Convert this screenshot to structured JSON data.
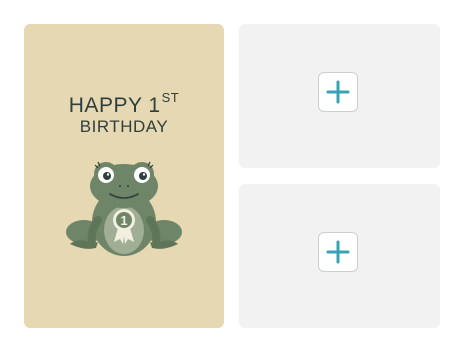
{
  "card": {
    "title_line1": "HAPPY 1",
    "title_line1_sup": "ST",
    "title_line2": "BIRTHDAY",
    "badge_number": "1",
    "background_color": "#e6d8b3",
    "text_color": "#2f3f3d"
  },
  "slots": [
    {
      "action": "add",
      "icon": "plus-icon"
    },
    {
      "action": "add",
      "icon": "plus-icon"
    }
  ],
  "colors": {
    "accent": "#3aa3b3",
    "slot_background": "#f2f2f2"
  }
}
